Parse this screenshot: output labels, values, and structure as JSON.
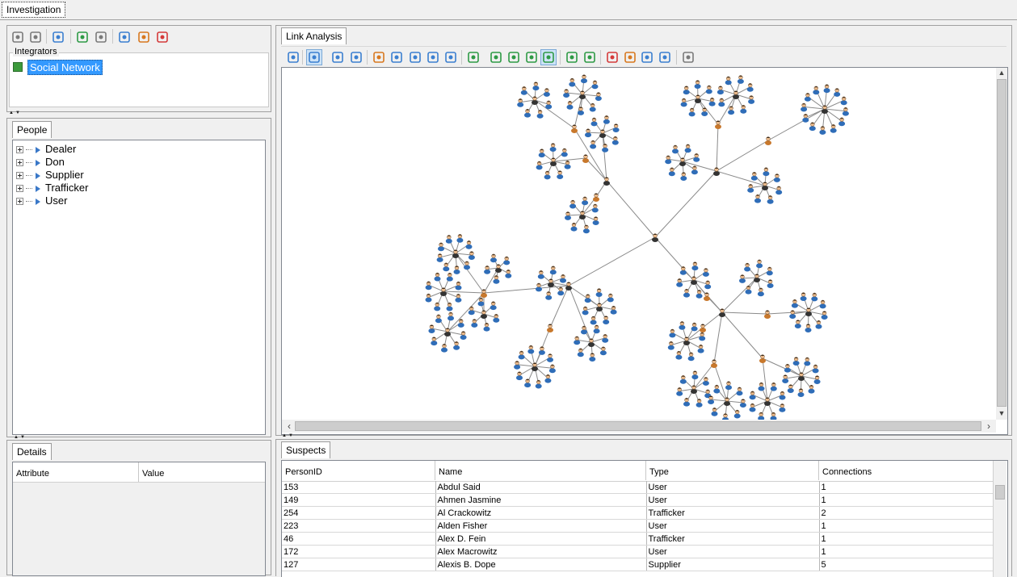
{
  "window": {
    "tab_label": "Investigation"
  },
  "integrators": {
    "legend": "Integrators",
    "items": [
      {
        "label": "Social Network"
      }
    ]
  },
  "people": {
    "tab_label": "People",
    "items": [
      {
        "label": "Dealer"
      },
      {
        "label": "Don"
      },
      {
        "label": "Supplier"
      },
      {
        "label": "Trafficker"
      },
      {
        "label": "User"
      }
    ]
  },
  "details": {
    "tab_label": "Details",
    "columns": [
      "Attribute",
      "Value"
    ]
  },
  "link_analysis": {
    "tab_label": "Link Analysis"
  },
  "suspects": {
    "tab_label": "Suspects",
    "columns": [
      "PersonID",
      "Name",
      "Type",
      "Connections"
    ],
    "rows": [
      [
        "153",
        "Abdul Said",
        "User",
        "1"
      ],
      [
        "149",
        "Ahmen Jasmine",
        "User",
        "1"
      ],
      [
        "254",
        "Al Crackowitz",
        "Trafficker",
        "2"
      ],
      [
        "223",
        "Alden Fisher",
        "User",
        "1"
      ],
      [
        "46",
        "Alex D. Fein",
        "Trafficker",
        "1"
      ],
      [
        "172",
        "Alex Macrowitz",
        "User",
        "1"
      ],
      [
        "127",
        "Alexis B. Dope",
        "Supplier",
        "5"
      ]
    ]
  },
  "colors": {
    "selection": "#3399ff",
    "edge": "#8a8a8a",
    "person_shirt": "#2f6db8",
    "hub_shirt": "#333333",
    "supplier_shirt": "#c8782c"
  },
  "icons": {
    "left_toolbar": [
      "undo-icon",
      "redo-icon",
      "search-icon",
      "import-icon",
      "export-icon",
      "copy-icon",
      "table-icon",
      "delete-icon"
    ],
    "graph_toolbar": [
      "overview-icon",
      "pointer-icon",
      "pan-icon",
      "move-icon",
      "zoom-box-icon",
      "zoom-fit-icon",
      "zoom-in-icon",
      "zoom-out-icon",
      "zoom-actual-icon",
      "layout-grid-icon",
      "layout-circle-icon",
      "layout-tree-icon",
      "layout-hierarchy-icon",
      "layout-organic-icon",
      "layout-radial-icon",
      "layout-symmetric-icon",
      "path-icon",
      "center-icon",
      "cluster-icon",
      "cut-icon",
      "settings-icon"
    ]
  }
}
